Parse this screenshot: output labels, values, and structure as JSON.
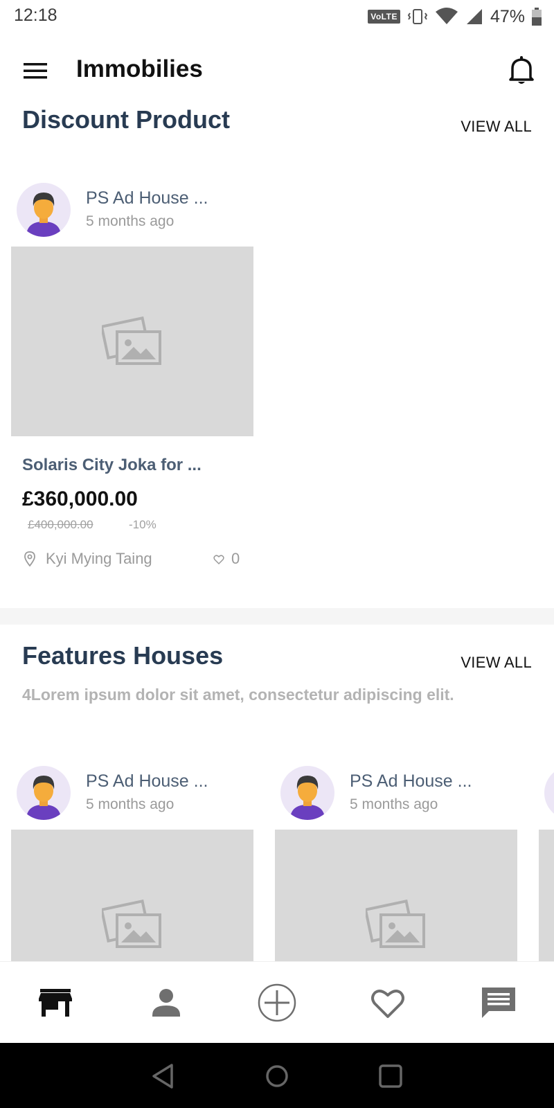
{
  "status_bar": {
    "time": "12:18",
    "volte": "VoLTE",
    "battery": "47%"
  },
  "app_bar": {
    "title": "Immobilies",
    "menu_icon": "menu-icon",
    "notification_icon": "bell-icon"
  },
  "discount_section": {
    "title": "Discount Product",
    "view_all": "VIEW ALL",
    "items": [
      {
        "seller": "PS Ad House ...",
        "posted": "5 months ago",
        "title": "Solaris City Joka for ...",
        "price": "£360,000.00",
        "old_price": "£400,000.00",
        "discount": "-10%",
        "location": "Kyi Mying Taing",
        "favorites": "0"
      }
    ]
  },
  "features_section": {
    "title": "Features Houses",
    "view_all": "VIEW ALL",
    "description": "4Lorem ipsum dolor sit amet, consectetur adipiscing elit.",
    "items": [
      {
        "seller": "PS Ad House ...",
        "posted": "5 months ago"
      },
      {
        "seller": "PS Ad House ...",
        "posted": "5 months ago"
      }
    ]
  },
  "bottom_nav": {
    "items": [
      "store-icon",
      "person-icon",
      "add-circle-icon",
      "heart-icon",
      "chat-icon"
    ],
    "active_color": "#111111",
    "inactive_color": "#6f6f6f"
  },
  "colors": {
    "heading": "#283b52",
    "card_title": "#4c5e74",
    "placeholder": "#d9d9d9",
    "avatar_bg": "#ece6f6",
    "avatar_shirt": "#6a3fbf"
  }
}
